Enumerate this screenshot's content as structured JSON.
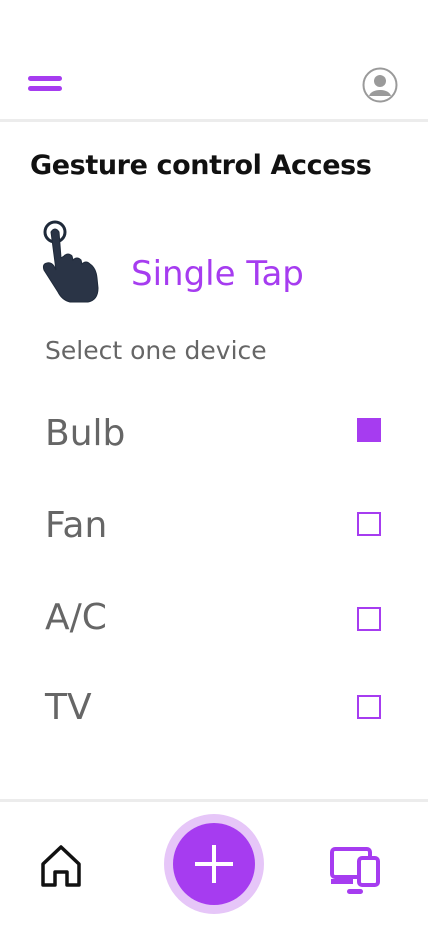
{
  "header": {
    "menu_icon": "hamburger-menu-icon",
    "profile_icon": "user-avatar-icon"
  },
  "main": {
    "title": "Gesture control Access",
    "gesture_icon": "hand-tap-icon",
    "gesture_name": "Single Tap",
    "instruction": "Select one device",
    "devices": [
      {
        "label": "Bulb",
        "checked": true
      },
      {
        "label": "Fan",
        "checked": false
      },
      {
        "label": "A/C",
        "checked": false
      },
      {
        "label": "TV",
        "checked": false
      }
    ]
  },
  "bottom_nav": {
    "home_icon": "home-icon",
    "add_icon": "plus-icon",
    "devices_icon": "devices-icon"
  },
  "colors": {
    "accent": "#a63cf0",
    "accent_light": "#e6c6f8",
    "text_dark": "#111111",
    "text_muted": "#666666"
  }
}
